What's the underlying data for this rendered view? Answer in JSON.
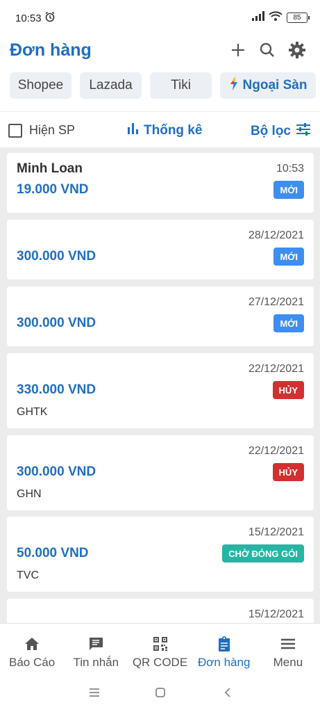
{
  "status_bar": {
    "time": "10:53",
    "battery": "85"
  },
  "header": {
    "title": "Đơn hàng"
  },
  "platforms": [
    "Shopee",
    "Lazada",
    "Tiki",
    "Ngoại Sàn"
  ],
  "filter_bar": {
    "show_products": "Hiện SP",
    "stats": "Thống kê",
    "filter": "Bộ lọc"
  },
  "orders": [
    {
      "name": "Minh Loan",
      "date": "10:53",
      "amount": "19.000 VND",
      "status": "MỚI",
      "status_color": "#3d8ef0",
      "carrier": ""
    },
    {
      "name": "",
      "date": "28/12/2021",
      "amount": "300.000 VND",
      "status": "MỚI",
      "status_color": "#3d8ef0",
      "carrier": ""
    },
    {
      "name": "",
      "date": "27/12/2021",
      "amount": "300.000 VND",
      "status": "MỚI",
      "status_color": "#3d8ef0",
      "carrier": ""
    },
    {
      "name": "",
      "date": "22/12/2021",
      "amount": "330.000 VND",
      "status": "HỦY",
      "status_color": "#d32f2f",
      "carrier": "GHTK"
    },
    {
      "name": "",
      "date": "22/12/2021",
      "amount": "300.000 VND",
      "status": "HỦY",
      "status_color": "#d32f2f",
      "carrier": "GHN"
    },
    {
      "name": "",
      "date": "15/12/2021",
      "amount": "50.000 VND",
      "status": "CHỜ ĐÓNG GÓI",
      "status_color": "#26b5a3",
      "carrier": "TVC"
    },
    {
      "name": "",
      "date": "15/12/2021",
      "amount": "",
      "status": "",
      "status_color": "",
      "carrier": ""
    }
  ],
  "bottom_nav": [
    {
      "label": "Báo Cáo",
      "icon": "home-icon"
    },
    {
      "label": "Tin nhắn",
      "icon": "message-icon"
    },
    {
      "label": "QR CODE",
      "icon": "qr-code-icon"
    },
    {
      "label": "Đơn hàng",
      "icon": "clipboard-icon",
      "active": true
    },
    {
      "label": "Menu",
      "icon": "menu-icon"
    }
  ],
  "colors": {
    "accent": "#1f6fc1",
    "new": "#3d8ef0",
    "cancel": "#d32f2f",
    "packing": "#26b5a3"
  }
}
